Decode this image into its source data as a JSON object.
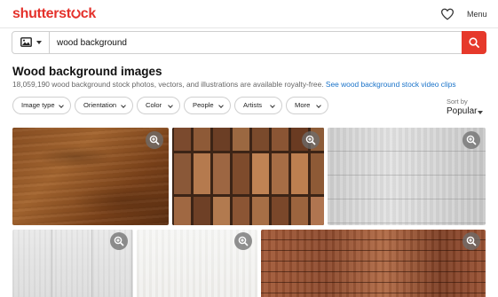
{
  "header": {
    "logo_part1": "shutter",
    "logo_part2": "st",
    "logo_part3": "ck",
    "favorites_icon": "heart-icon",
    "menu_label": "Menu"
  },
  "search": {
    "type_icon": "image-icon",
    "query": "wood background",
    "submit_icon": "search-icon"
  },
  "results": {
    "title": "Wood background images",
    "count_text": "18,059,190 wood background stock photos, vectors, and illustrations are available royalty-free.",
    "video_link": "See wood background stock video clips"
  },
  "filters": [
    {
      "label": "Image type"
    },
    {
      "label": "Orientation"
    },
    {
      "label": "Color"
    },
    {
      "label": "People"
    },
    {
      "label": "Artists"
    },
    {
      "label": "More"
    }
  ],
  "sort": {
    "label": "Sort by",
    "value": "Popular"
  },
  "images": [
    {
      "description": "dark brown plywood texture",
      "action_icon": "zoom-in-icon"
    },
    {
      "description": "wooden block wall",
      "action_icon": "zoom-in-icon"
    },
    {
      "description": "white wood planks",
      "action_icon": "zoom-in-icon"
    },
    {
      "description": "light grey wood panels",
      "action_icon": "zoom-in-icon"
    },
    {
      "description": "white wood texture",
      "action_icon": "zoom-in-icon"
    },
    {
      "description": "red brown wood planks",
      "action_icon": "zoom-in-icon"
    }
  ],
  "colors": {
    "brand": "#e4312b",
    "search_button": "#e6392b",
    "link": "#1a73c9"
  }
}
